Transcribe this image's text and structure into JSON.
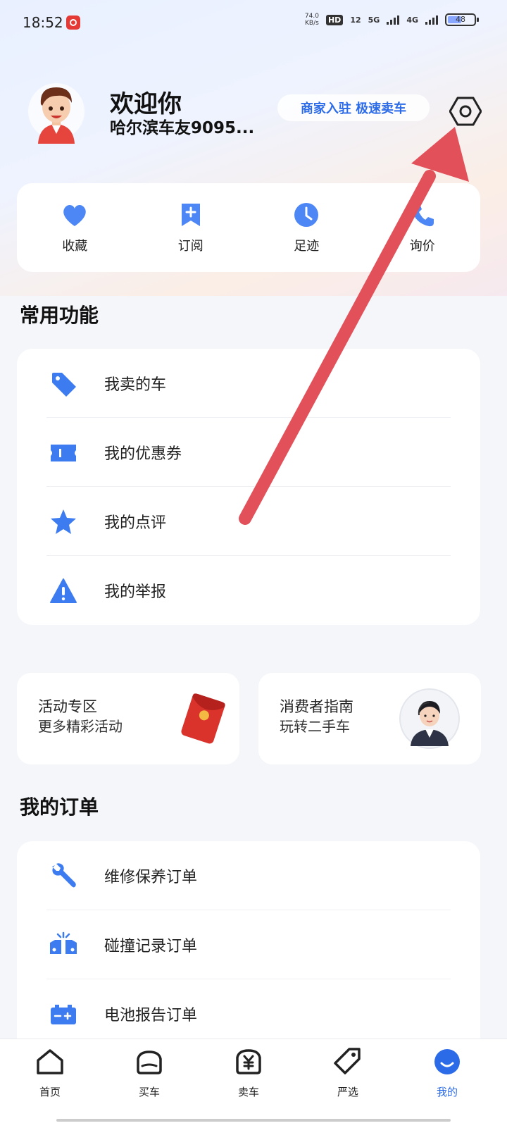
{
  "status_bar": {
    "time": "18:52",
    "net_speed_value": "74.0",
    "net_speed_unit": "KB/s",
    "hd_label": "HD",
    "sim1": "1",
    "sim2": "2",
    "sig_5g": "5G",
    "sig_4g": "4G",
    "battery": "48",
    "battery_level_percent": 48
  },
  "header": {
    "welcome": "欢迎你",
    "username": "哈尔滨车友9095...",
    "merchant_button": "商家入驻 极速卖车",
    "settings_icon": "gear-hexagon-icon"
  },
  "quick_actions": [
    {
      "label": "收藏",
      "icon": "heart-icon"
    },
    {
      "label": "订阅",
      "icon": "bookmark-plus-icon"
    },
    {
      "label": "足迹",
      "icon": "clock-icon"
    },
    {
      "label": "询价",
      "icon": "phone-icon"
    }
  ],
  "common": {
    "title": "常用功能",
    "items": [
      {
        "label": "我卖的车",
        "icon": "tag-icon"
      },
      {
        "label": "我的优惠券",
        "icon": "coupon-icon"
      },
      {
        "label": "我的点评",
        "icon": "star-icon"
      },
      {
        "label": "我的举报",
        "icon": "warning-icon"
      }
    ]
  },
  "promos": [
    {
      "line1": "活动专区",
      "line2": "更多精彩活动",
      "icon": "red-envelope-icon"
    },
    {
      "line1": "消费者指南",
      "line2": "玩转二手车",
      "icon": "customer-service-avatar-icon"
    }
  ],
  "orders": {
    "title": "我的订单",
    "items": [
      {
        "label": "维修保养订单",
        "icon": "wrench-icon"
      },
      {
        "label": "碰撞记录订单",
        "icon": "collision-car-icon"
      },
      {
        "label": "电池报告订单",
        "icon": "battery-icon"
      }
    ]
  },
  "tabs": [
    {
      "label": "首页",
      "icon": "home-icon"
    },
    {
      "label": "买车",
      "icon": "car-icon"
    },
    {
      "label": "卖车",
      "icon": "yuan-sell-icon"
    },
    {
      "label": "严选",
      "icon": "tag-outline-icon"
    },
    {
      "label": "我的",
      "icon": "profile-icon",
      "active": true
    }
  ],
  "colors": {
    "accent": "#2c6be8",
    "annotation_arrow": "#e2515a"
  }
}
